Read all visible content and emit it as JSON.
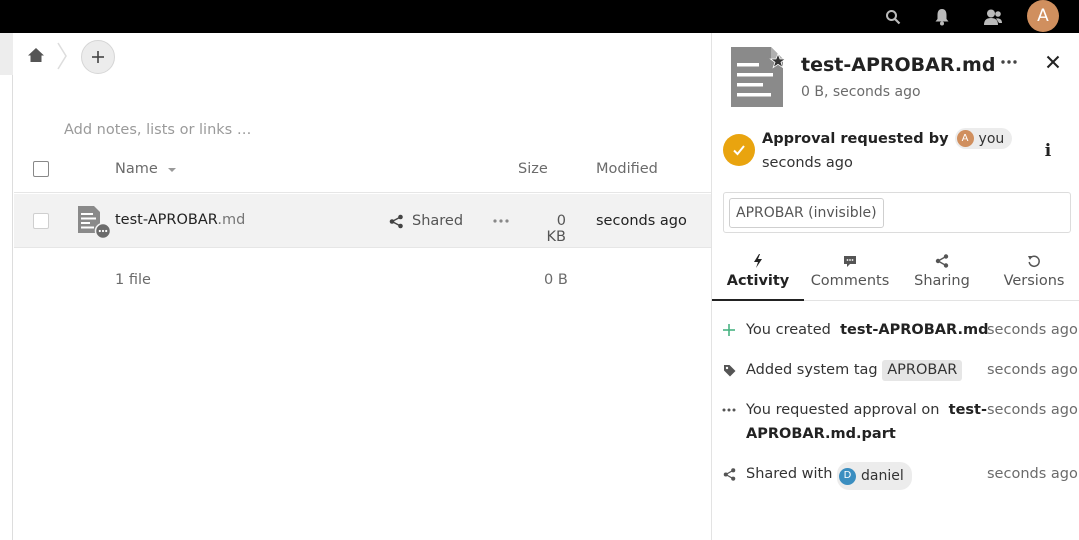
{
  "topbar": {
    "icons": [
      "search-icon",
      "bell-icon",
      "contacts-icon"
    ],
    "avatar_initial": "A"
  },
  "files": {
    "notes_placeholder": "Add notes, lists or links …",
    "columns": {
      "name": "Name",
      "size": "Size",
      "modified": "Modified"
    },
    "rows": [
      {
        "name_base": "test-APROBAR",
        "name_ext": ".md",
        "share_label": "Shared",
        "size": "0 KB",
        "modified": "seconds ago"
      }
    ],
    "summary": {
      "count": "1 file",
      "size": "0 B"
    }
  },
  "sidebar": {
    "title": "test-APROBAR.md",
    "subtitle": "0 B, seconds ago",
    "approval": {
      "label": "Approval requested by",
      "user_initial": "A",
      "user_name": "you",
      "time": "seconds ago",
      "color": "#e9a40f"
    },
    "tag": "APROBAR (invisible)",
    "tabs": [
      {
        "label": "Activity",
        "icon": "bolt-icon",
        "active": true
      },
      {
        "label": "Comments",
        "icon": "comment-icon",
        "active": false
      },
      {
        "label": "Sharing",
        "icon": "share-icon",
        "active": false
      },
      {
        "label": "Versions",
        "icon": "history-icon",
        "active": false
      }
    ],
    "activity": [
      {
        "icon": "plus-icon",
        "text": "You created",
        "bold": "test-APROBAR.md",
        "time": "seconds ago"
      },
      {
        "icon": "tag-icon",
        "text": "Added system tag",
        "tag": "APROBAR",
        "time": "seconds ago"
      },
      {
        "icon": "more-icon",
        "text": "You requested approval on",
        "bold_1": "test-",
        "bold_2": "APROBAR.md.part",
        "time": "seconds ago"
      },
      {
        "icon": "share-icon",
        "text": "Shared with",
        "user_initial": "D",
        "user_name": "daniel",
        "time": "seconds ago"
      }
    ]
  }
}
